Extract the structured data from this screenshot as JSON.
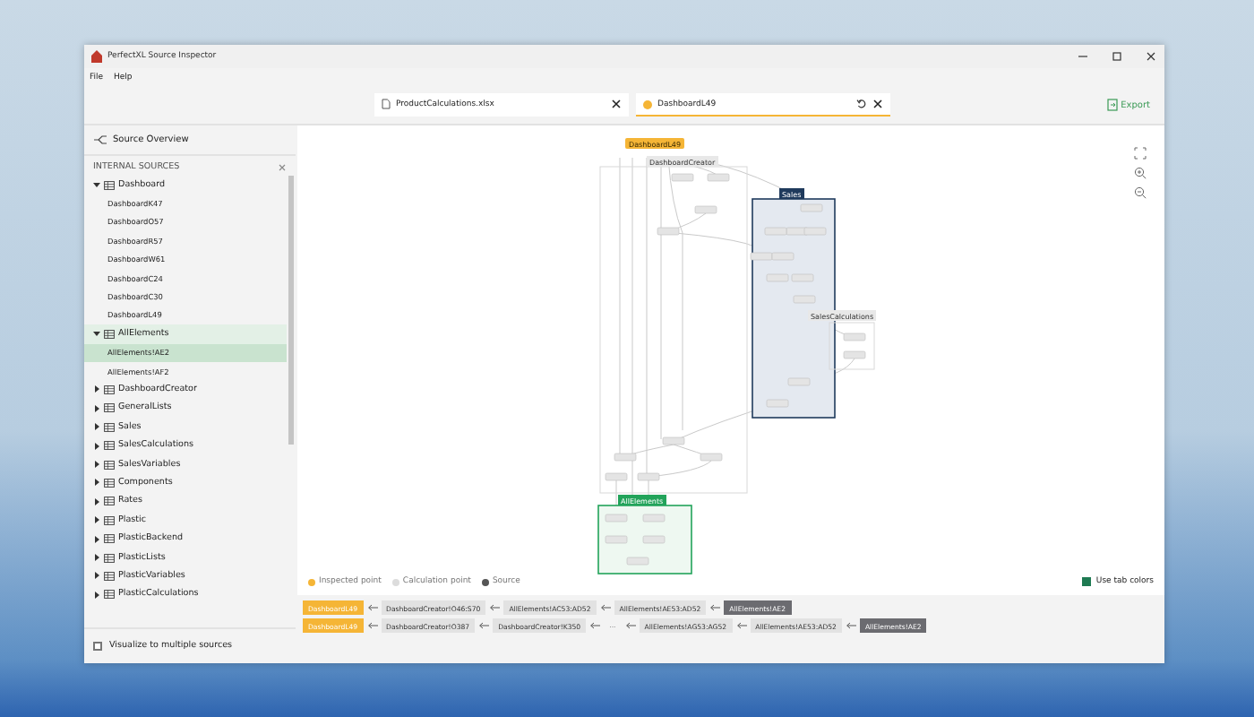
{
  "window": {
    "title": "PerfectXL Source Inspector"
  },
  "menu": [
    "File",
    "Help"
  ],
  "tabs": [
    {
      "label": "ProductCalculations.xlsx",
      "kind": "file",
      "selected": false
    },
    {
      "label": "DashboardL49",
      "kind": "point",
      "selected": true
    }
  ],
  "export": "Export",
  "sidebar": {
    "overview": "Source Overview",
    "section": "INTERNAL SOURCES",
    "tree": [
      {
        "label": "Dashboard",
        "expanded": true,
        "selected": false,
        "children": [
          {
            "label": "DashboardK47",
            "selected": false
          },
          {
            "label": "DashboardO57",
            "selected": false
          },
          {
            "label": "DashboardR57",
            "selected": false
          },
          {
            "label": "DashboardW61",
            "selected": false
          },
          {
            "label": "DashboardC24",
            "selected": false
          },
          {
            "label": "DashboardC30",
            "selected": false
          },
          {
            "label": "DashboardL49",
            "selected": false
          }
        ]
      },
      {
        "label": "AllElements",
        "expanded": true,
        "selected": true,
        "children": [
          {
            "label": "AllElements!AE2",
            "selected": true
          },
          {
            "label": "AllElements!AF2",
            "selected": false
          }
        ]
      },
      {
        "label": "DashboardCreator",
        "expanded": false,
        "selected": false
      },
      {
        "label": "GeneralLists",
        "expanded": false,
        "selected": false
      },
      {
        "label": "Sales",
        "expanded": false,
        "selected": false
      },
      {
        "label": "SalesCalculations",
        "expanded": false,
        "selected": false
      },
      {
        "label": "SalesVariables",
        "expanded": false,
        "selected": false
      },
      {
        "label": "Components",
        "expanded": false,
        "selected": false
      },
      {
        "label": "Rates",
        "expanded": false,
        "selected": false
      },
      {
        "label": "Plastic",
        "expanded": false,
        "selected": false
      },
      {
        "label": "PlasticBackend",
        "expanded": false,
        "selected": false
      },
      {
        "label": "PlasticLists",
        "expanded": false,
        "selected": false
      },
      {
        "label": "PlasticVariables",
        "expanded": false,
        "selected": false
      },
      {
        "label": "PlasticCalculations",
        "expanded": false,
        "selected": false
      }
    ],
    "multi": {
      "label": "Visualize to multiple sources",
      "checked": false
    }
  },
  "diagram": {
    "top": "DashboardL49",
    "groups": [
      {
        "label": "DashboardCreator",
        "kind": "outline",
        "color": "#e8e8e8"
      },
      {
        "label": "Sales",
        "kind": "filled",
        "color": "#1f3a5c"
      },
      {
        "label": "SalesCalculations",
        "kind": "outline",
        "color": "#e8e8e8"
      },
      {
        "label": "AllElements",
        "kind": "filled",
        "color": "#22a35a"
      }
    ]
  },
  "legend": [
    {
      "label": "Inspected point",
      "color": "#f5b536"
    },
    {
      "label": "Calculation point",
      "color": "#dcdcdc"
    },
    {
      "label": "Source",
      "color": "#555555"
    }
  ],
  "tab_colors": {
    "label": "Use tab colors",
    "checked": true
  },
  "paths": [
    [
      {
        "label": "DashboardL49",
        "kind": "inspected"
      },
      {
        "label": "DashboardCreator!O46:S70",
        "kind": "calc"
      },
      {
        "label": "AllElements!AC53:AD52",
        "kind": "calc"
      },
      {
        "label": "AllElements!AE53:AD52",
        "kind": "calc"
      },
      {
        "label": "AllElements!AE2",
        "kind": "source"
      }
    ],
    [
      {
        "label": "DashboardL49",
        "kind": "inspected"
      },
      {
        "label": "DashboardCreator!O387",
        "kind": "calc"
      },
      {
        "label": "DashboardCreator!K350",
        "kind": "calc"
      },
      {
        "label": "···",
        "kind": "more"
      },
      {
        "label": "AllElements!AG53:AG52",
        "kind": "calc"
      },
      {
        "label": "AllElements!AE53:AD52",
        "kind": "calc"
      },
      {
        "label": "AllElements!AE2",
        "kind": "source"
      }
    ]
  ]
}
